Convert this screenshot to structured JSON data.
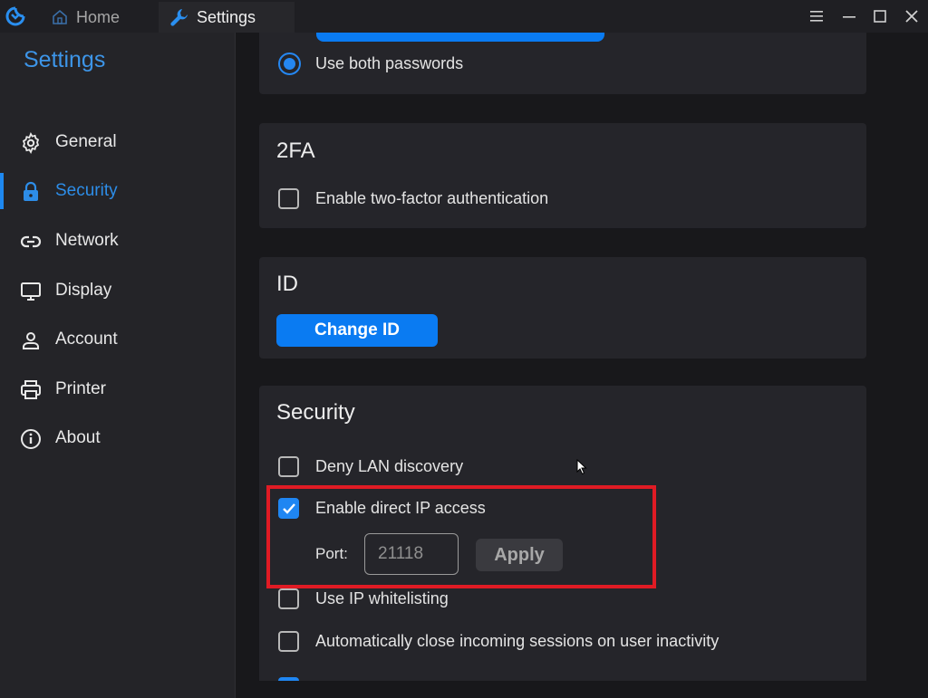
{
  "titlebar": {
    "tabs": [
      {
        "label": "Home",
        "icon": "home-icon"
      },
      {
        "label": "Settings",
        "icon": "wrench-icon"
      }
    ]
  },
  "sidebar": {
    "title": "Settings",
    "items": [
      {
        "label": "General",
        "icon": "gear-icon"
      },
      {
        "label": "Security",
        "icon": "lock-icon",
        "active": true
      },
      {
        "label": "Network",
        "icon": "link-icon"
      },
      {
        "label": "Display",
        "icon": "monitor-icon"
      },
      {
        "label": "Account",
        "icon": "person-icon"
      },
      {
        "label": "Printer",
        "icon": "printer-icon"
      },
      {
        "label": "About",
        "icon": "info-icon"
      }
    ]
  },
  "main": {
    "password": {
      "option_label": "Use both passwords"
    },
    "twofa": {
      "title": "2FA",
      "enable_label": "Enable two-factor authentication"
    },
    "id": {
      "title": "ID",
      "change_button": "Change ID"
    },
    "security": {
      "title": "Security",
      "deny_lan": "Deny LAN discovery",
      "direct_ip": "Enable direct IP access",
      "port_label": "Port:",
      "port_value": "21118",
      "apply_label": "Apply",
      "ip_whitelist": "Use IP whitelisting",
      "auto_close": "Automatically close incoming sessions on user inactivity"
    }
  },
  "colors": {
    "accent": "#1f86f2",
    "sidebar_title": "#3d95e8",
    "highlight": "#e01b24"
  }
}
